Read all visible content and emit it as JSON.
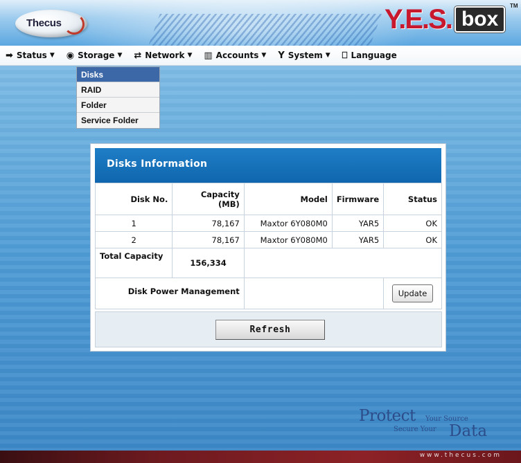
{
  "header": {
    "brand_logo": "Thecus",
    "product_logo_yes": "Y.E.S.",
    "product_logo_box": "box",
    "trademark": "TM"
  },
  "nav": {
    "items": [
      {
        "label": "Status",
        "icon": "status-icon"
      },
      {
        "label": "Storage",
        "icon": "disk-icon"
      },
      {
        "label": "Network",
        "icon": "network-icon"
      },
      {
        "label": "Accounts",
        "icon": "accounts-icon"
      },
      {
        "label": "System",
        "icon": "system-icon"
      },
      {
        "label": "Language",
        "icon": "language-icon"
      }
    ]
  },
  "submenu": {
    "items": [
      "Disks",
      "RAID",
      "Folder",
      "Service Folder"
    ],
    "active": "Disks"
  },
  "panel": {
    "title": "Disks Information",
    "columns": [
      "Disk No.",
      "Capacity (MB)",
      "Model",
      "Firmware",
      "Status"
    ],
    "rows": [
      {
        "disk_no": "1",
        "capacity": "78,167",
        "model": "Maxtor 6Y080M0",
        "firmware": "YAR5",
        "status": "OK"
      },
      {
        "disk_no": "2",
        "capacity": "78,167",
        "model": "Maxtor 6Y080M0",
        "firmware": "YAR5",
        "status": "OK"
      }
    ],
    "total_label": "Total Capacity",
    "total_value": "156,334",
    "power_label": "Disk Power Management",
    "update_label": "Update",
    "refresh_label": "Refresh"
  },
  "tagline": {
    "protect": "Protect",
    "your_source": "Your Source",
    "secure_your": "Secure Your",
    "data": "Data"
  },
  "footer": {
    "url": "www.thecus.com"
  },
  "colors": {
    "panel_title_bg": "#1473bb",
    "submenu_active_bg": "#3c68a8",
    "logo_red": "#c8182e",
    "footer_bg": "#7a1e22"
  }
}
